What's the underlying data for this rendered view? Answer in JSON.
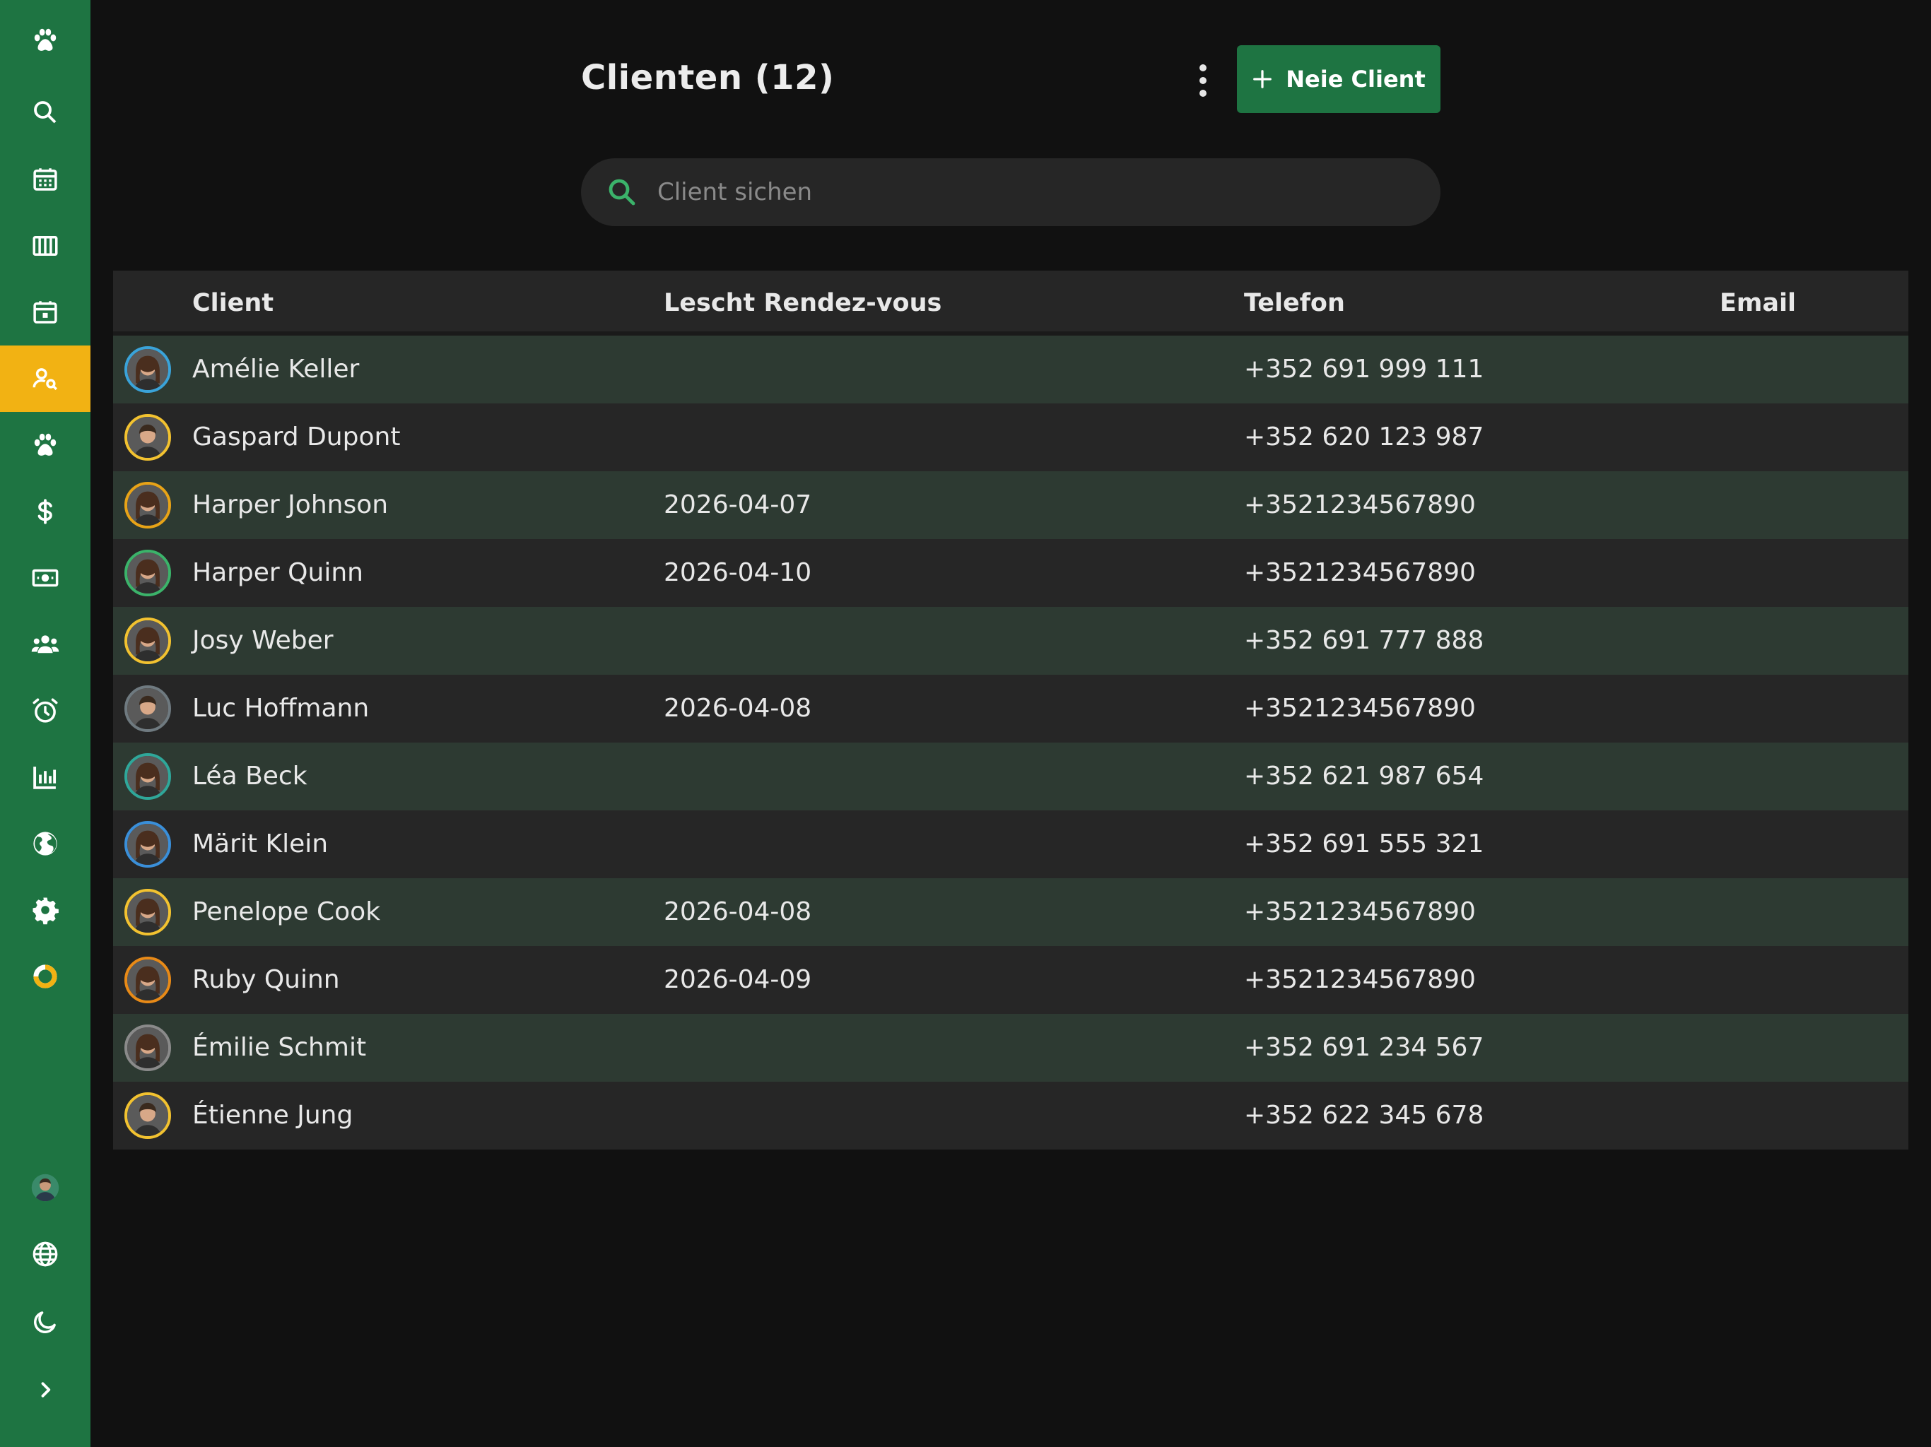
{
  "sidebar": {
    "items": [
      {
        "icon": "paw-icon",
        "active": false
      },
      {
        "icon": "search-icon",
        "active": false
      },
      {
        "icon": "calendar-icon",
        "active": false
      },
      {
        "icon": "columns-icon",
        "active": false
      },
      {
        "icon": "calendar-day-icon",
        "active": false
      },
      {
        "icon": "client-search-icon",
        "active": true
      },
      {
        "icon": "paw-icon",
        "active": false
      },
      {
        "icon": "dollar-icon",
        "active": false
      },
      {
        "icon": "banknote-icon",
        "active": false
      },
      {
        "icon": "users-icon",
        "active": false
      },
      {
        "icon": "alarm-icon",
        "active": false
      },
      {
        "icon": "bar-chart-icon",
        "active": false
      },
      {
        "icon": "globe-filled-icon",
        "active": false
      },
      {
        "icon": "settings-icon",
        "active": false
      },
      {
        "icon": "ring-progress-icon",
        "active": false
      }
    ],
    "bottom": [
      {
        "icon": "user-avatar"
      },
      {
        "icon": "globe-icon"
      },
      {
        "icon": "moon-icon"
      },
      {
        "icon": "chevron-right-icon"
      }
    ],
    "colors": {
      "background": "#1e7442",
      "active": "#f2b213"
    }
  },
  "header": {
    "title": "Clienten (12)",
    "new_button_label": "Neie Client"
  },
  "search": {
    "placeholder": "Client sichen",
    "value": ""
  },
  "table": {
    "columns": {
      "client": "Client",
      "last_appointment": "Lescht Rendez-vous",
      "phone": "Telefon",
      "email": "Email"
    },
    "rows": [
      {
        "name": "Amélie Keller",
        "last": "",
        "phone": "+352 691 999 111",
        "email": "",
        "ring": "#3aa3d9",
        "gender": "f"
      },
      {
        "name": "Gaspard Dupont",
        "last": "",
        "phone": "+352 620 123 987",
        "email": "",
        "ring": "#f2c230",
        "gender": "m"
      },
      {
        "name": "Harper Johnson",
        "last": "2026-04-07",
        "phone": "+3521234567890",
        "email": "",
        "ring": "#e8a317",
        "gender": "f"
      },
      {
        "name": "Harper Quinn",
        "last": "2026-04-10",
        "phone": "+3521234567890",
        "email": "",
        "ring": "#3bb36a",
        "gender": "f"
      },
      {
        "name": "Josy Weber",
        "last": "",
        "phone": "+352 691 777 888",
        "email": "",
        "ring": "#f2c230",
        "gender": "f"
      },
      {
        "name": "Luc Hoffmann",
        "last": "2026-04-08",
        "phone": "+3521234567890",
        "email": "",
        "ring": "#6f7a80",
        "gender": "m"
      },
      {
        "name": "Léa Beck",
        "last": "",
        "phone": "+352 621 987 654",
        "email": "",
        "ring": "#2fa79a",
        "gender": "f"
      },
      {
        "name": "Märit Klein",
        "last": "",
        "phone": "+352 691 555 321",
        "email": "",
        "ring": "#3a8fd9",
        "gender": "f"
      },
      {
        "name": "Penelope Cook",
        "last": "2026-04-08",
        "phone": "+3521234567890",
        "email": "",
        "ring": "#f2c230",
        "gender": "f"
      },
      {
        "name": "Ruby Quinn",
        "last": "2026-04-09",
        "phone": "+3521234567890",
        "email": "",
        "ring": "#e88a17",
        "gender": "f"
      },
      {
        "name": "Émilie Schmit",
        "last": "",
        "phone": "+352 691 234 567",
        "email": "",
        "ring": "#8a8a8a",
        "gender": "f"
      },
      {
        "name": "Étienne Jung",
        "last": "",
        "phone": "+352 622 345 678",
        "email": "",
        "ring": "#f2c230",
        "gender": "m"
      }
    ]
  },
  "colors": {
    "page_bg": "#111111",
    "row_even": "#2d3a32",
    "row_odd": "#262626",
    "accent_green": "#1e7442",
    "search_icon": "#3bb36a"
  }
}
